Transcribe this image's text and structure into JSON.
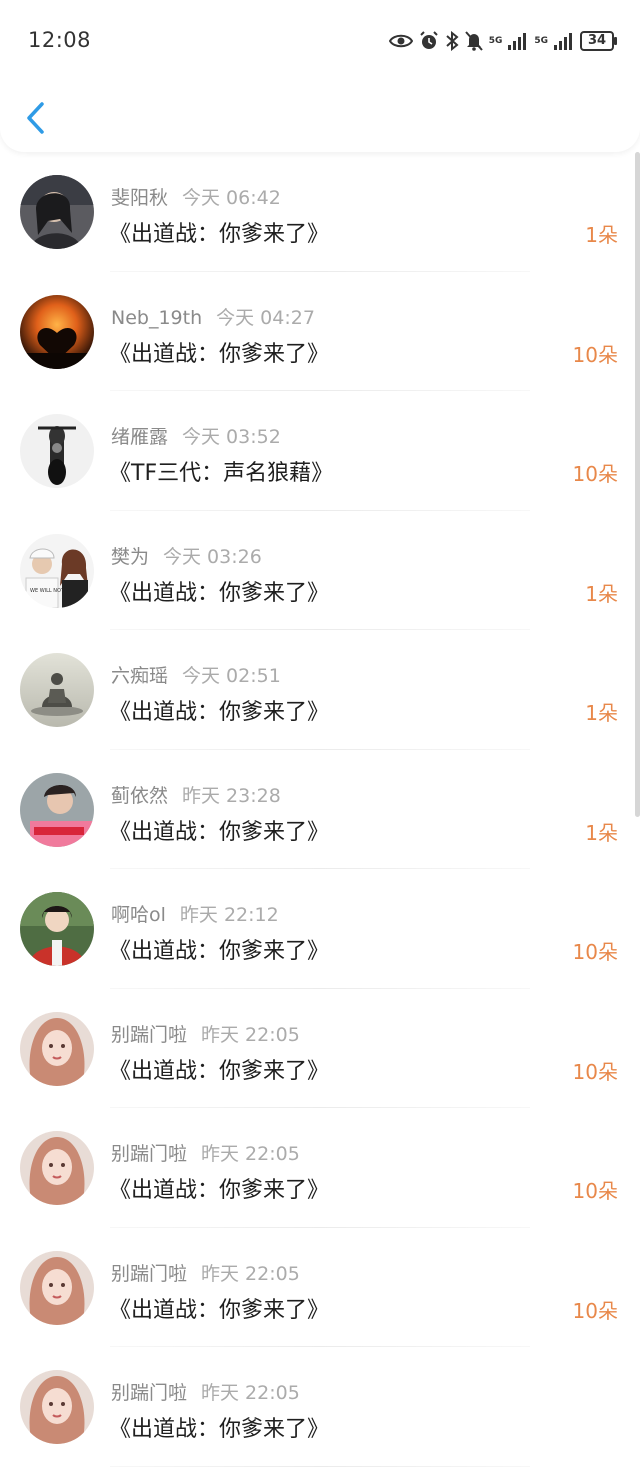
{
  "status": {
    "time": "12:08",
    "battery": "34",
    "net1": "5G",
    "net2": "5G"
  },
  "colors": {
    "accent": "#2f9be6",
    "amount": "#e8884a"
  },
  "items": [
    {
      "name": "斐阳秋",
      "date": "今天 06:42",
      "title": "《出道战：你爹来了》",
      "amount": "1朵",
      "avatar": "avatar-dark-girl"
    },
    {
      "name": "Neb_19th",
      "date": "今天 04:27",
      "title": "《出道战：你爹来了》",
      "amount": "10朵",
      "avatar": "avatar-sunset-heart"
    },
    {
      "name": "绪雁露",
      "date": "今天 03:52",
      "title": "《TF三代：声名狼藉》",
      "amount": "10朵",
      "avatar": "avatar-motorcycle"
    },
    {
      "name": "樊为",
      "date": "今天 03:26",
      "title": "《出道战：你爹来了》",
      "amount": "1朵",
      "avatar": "avatar-couple"
    },
    {
      "name": "六痴瑶",
      "date": "今天 02:51",
      "title": "《出道战：你爹来了》",
      "amount": "1朵",
      "avatar": "avatar-buddha"
    },
    {
      "name": "蓟依然",
      "date": "昨天 23:28",
      "title": "《出道战：你爹来了》",
      "amount": "1朵",
      "avatar": "avatar-boy-pink"
    },
    {
      "name": "啊哈ol",
      "date": "昨天 22:12",
      "title": "《出道战：你爹来了》",
      "amount": "10朵",
      "avatar": "avatar-boy-jacket"
    },
    {
      "name": "别踹门啦",
      "date": "昨天 22:05",
      "title": "《出道战：你爹来了》",
      "amount": "10朵",
      "avatar": "avatar-girl-pink"
    },
    {
      "name": "别踹门啦",
      "date": "昨天 22:05",
      "title": "《出道战：你爹来了》",
      "amount": "10朵",
      "avatar": "avatar-girl-pink"
    },
    {
      "name": "别踹门啦",
      "date": "昨天 22:05",
      "title": "《出道战：你爹来了》",
      "amount": "10朵",
      "avatar": "avatar-girl-pink"
    },
    {
      "name": "别踹门啦",
      "date": "昨天 22:05",
      "title": "《出道战：你爹来了》",
      "amount": "",
      "avatar": "avatar-girl-pink"
    }
  ]
}
